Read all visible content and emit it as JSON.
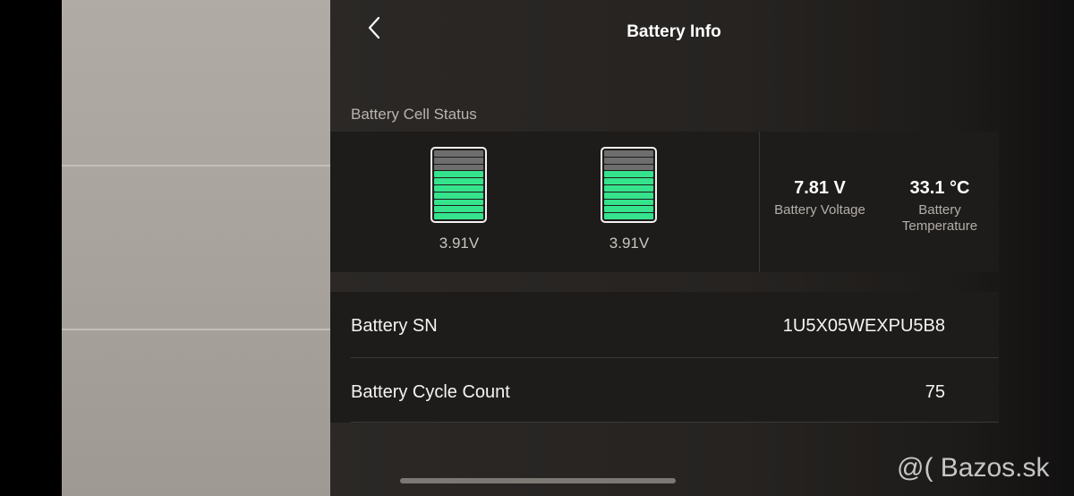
{
  "header": {
    "title": "Battery Info"
  },
  "cell_status": {
    "label": "Battery Cell Status",
    "cells": [
      {
        "voltage": "3.91V",
        "level": 0.7
      },
      {
        "voltage": "3.91V",
        "level": 0.7
      }
    ],
    "voltage": {
      "value": "7.81 V",
      "label": "Battery Voltage"
    },
    "temperature": {
      "value": "33.1 °C",
      "label_line1": "Battery",
      "label_line2": "Temperature"
    }
  },
  "info": {
    "sn_label": "Battery SN",
    "sn_value": "1U5X05WEXPU5B8",
    "cycle_label": "Battery Cycle Count",
    "cycle_value": "75"
  },
  "watermark": "@( Bazos.sk",
  "colors": {
    "battery_fill": "#35e38d",
    "battery_empty": "#6e6e6e"
  }
}
